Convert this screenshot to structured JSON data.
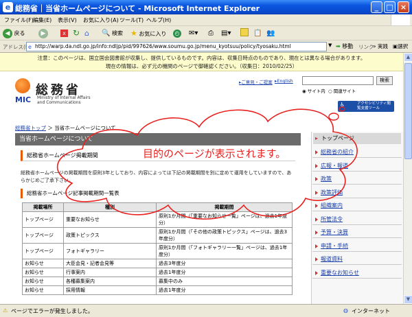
{
  "window": {
    "title": "総務省｜当省ホームページについて - Microsoft Internet Explorer",
    "app_icon": "ie-logo-icon"
  },
  "menu": [
    "ファイル(F)",
    "編集(E)",
    "表示(V)",
    "お気に入り(A)",
    "ツール(T)",
    "ヘルプ(H)"
  ],
  "toolbar": {
    "back": "戻る",
    "search": "検索",
    "favorites": "お気に入り"
  },
  "address": {
    "label": "アドレス(D)",
    "url": "http://warp.da.ndl.go.jp/info:ndljp/pid/997626/www.soumu.go.jp/menu_kyotsuu/policy/tyosaku.html",
    "go": "移動",
    "links": "リンク",
    "jissen": "実践",
    "sentaku": "選択"
  },
  "notice": {
    "line1": "注意：このページは、国立国会図書館が収集し、提供しているものです。内容は、収集日時点のものであり、現在とは異なる場合があります。",
    "line2": "現在の情報は、必ず元の機関のページで御確認ください。（収集日：2010/02/25）"
  },
  "header": {
    "logo_text": "総務省",
    "logo_mic": "MIC",
    "logo_en1": "Ministry of Internal Affairs",
    "logo_en2": "and Communications",
    "link_opinion": "ご意見・ご提案",
    "link_english": "English",
    "search_button": "検索",
    "radio_site": "サイト内",
    "radio_related": "関連サイト",
    "access_tool": "アクセシビリティ閲覧支援ツール"
  },
  "breadcrumb": {
    "home": "総務省トップ",
    "sep": "＞",
    "current": "当省ホームページについて"
  },
  "main": {
    "page_title": "当省ホームページについて",
    "section1_title": "総務省ホームページ掲載期間",
    "section1_text1": "総務省ホームページの掲載期間を原則3年としており、内容によっては下記の掲載期間を別に定めて運用をしていますので、あらかじめご了承下さい。",
    "section2_title": "総務省ホームページ記事掲載期間一覧表",
    "table_headers": [
      "掲載場所",
      "種別",
      "掲載期間"
    ],
    "table_rows": [
      [
        "トップページ",
        "重要なお知らせ",
        "原則1か月間（「重要なお知らせ一覧」ページは、過去1年度分）"
      ],
      [
        "トップページ",
        "政策トピックス",
        "原則1か月間（「その他の政策トピックス」ページは、過去3年度分）"
      ],
      [
        "トップページ",
        "フォトギャラリー",
        "原則1か月間（「フォトギャラリー一覧」ページは、過去1年度分）"
      ],
      [
        "お知らせ",
        "大臣会見・記者会見等",
        "過去3年度分"
      ],
      [
        "お知らせ",
        "行事案内",
        "過去1年度分"
      ],
      [
        "お知らせ",
        "各種募集案内",
        "募集中のみ"
      ],
      [
        "お知らせ",
        "採用情報",
        "過去1年度分"
      ]
    ]
  },
  "sidebar": {
    "top": "トップページ",
    "items": [
      "総務省の紹介",
      "広報・報道",
      "政策",
      "政策評価",
      "組織案内",
      "所管法令",
      "予算・決算",
      "申請・手続",
      "報道資料",
      "重要なお知らせ"
    ]
  },
  "annotation": {
    "text": "目的のページが表示されます。",
    "color": "#e8201e"
  },
  "status": {
    "message": "ページでエラーが発生しました。",
    "zone": "インターネット"
  },
  "colors": {
    "titlebar": "#0a55e0",
    "page_title_bg": "#6b6b6b",
    "accent_orange": "#e85b00",
    "link": "#1a3fa8"
  }
}
